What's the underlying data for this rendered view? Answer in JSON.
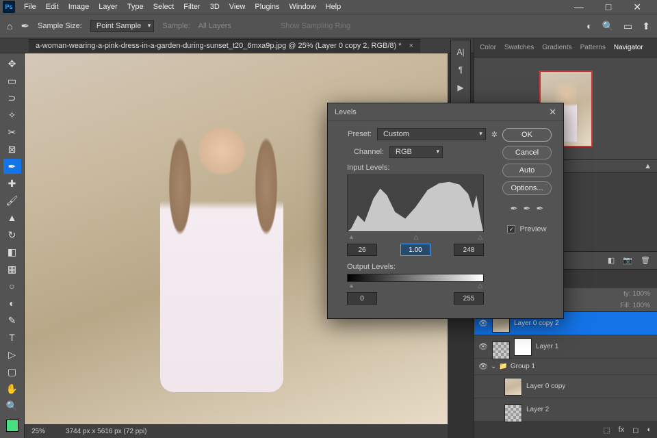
{
  "menubar": {
    "items": [
      "File",
      "Edit",
      "Image",
      "Layer",
      "Type",
      "Select",
      "Filter",
      "3D",
      "View",
      "Plugins",
      "Window",
      "Help"
    ]
  },
  "optbar": {
    "sample_size_label": "Sample Size:",
    "sample_size_value": "Point Sample",
    "sample_label": "Sample:",
    "sample_value": "All Layers",
    "show_ring": "Show Sampling Ring"
  },
  "doc": {
    "title": "a-woman-wearing-a-pink-dress-in-a-garden-during-sunset_t20_6mxa9p.jpg @ 25% (Layer 0 copy 2, RGB/8) *"
  },
  "status": {
    "zoom": "25%",
    "dims": "3744 px x 5616 px (72 ppi)"
  },
  "panels": {
    "tabs": [
      "Color",
      "Swatches",
      "Gradients",
      "Patterns",
      "Navigator"
    ],
    "active": "Navigator"
  },
  "props": {
    "opacity_label": "ty:",
    "opacity_val": "100%",
    "fill_label": "Fill:",
    "fill_val": "100%"
  },
  "layers": {
    "items": [
      {
        "name": "Layer 0 copy 2",
        "sel": true,
        "thumb": "photo"
      },
      {
        "name": "Layer 1",
        "thumb": "chk",
        "mask": true
      },
      {
        "name": "Group 1",
        "group": true
      },
      {
        "name": "Layer 0 copy",
        "thumb": "photo",
        "indent": true
      },
      {
        "name": "Layer 2",
        "thumb": "chk",
        "indent": true
      }
    ]
  },
  "dialog": {
    "title": "Levels",
    "preset_label": "Preset:",
    "preset_value": "Custom",
    "channel_label": "Channel:",
    "channel_value": "RGB",
    "input_label": "Input Levels:",
    "in_black": "26",
    "in_gamma": "1.00",
    "in_white": "248",
    "output_label": "Output Levels:",
    "out_black": "0",
    "out_white": "255",
    "btn_ok": "OK",
    "btn_cancel": "Cancel",
    "btn_auto": "Auto",
    "btn_options": "Options...",
    "preview": "Preview"
  }
}
